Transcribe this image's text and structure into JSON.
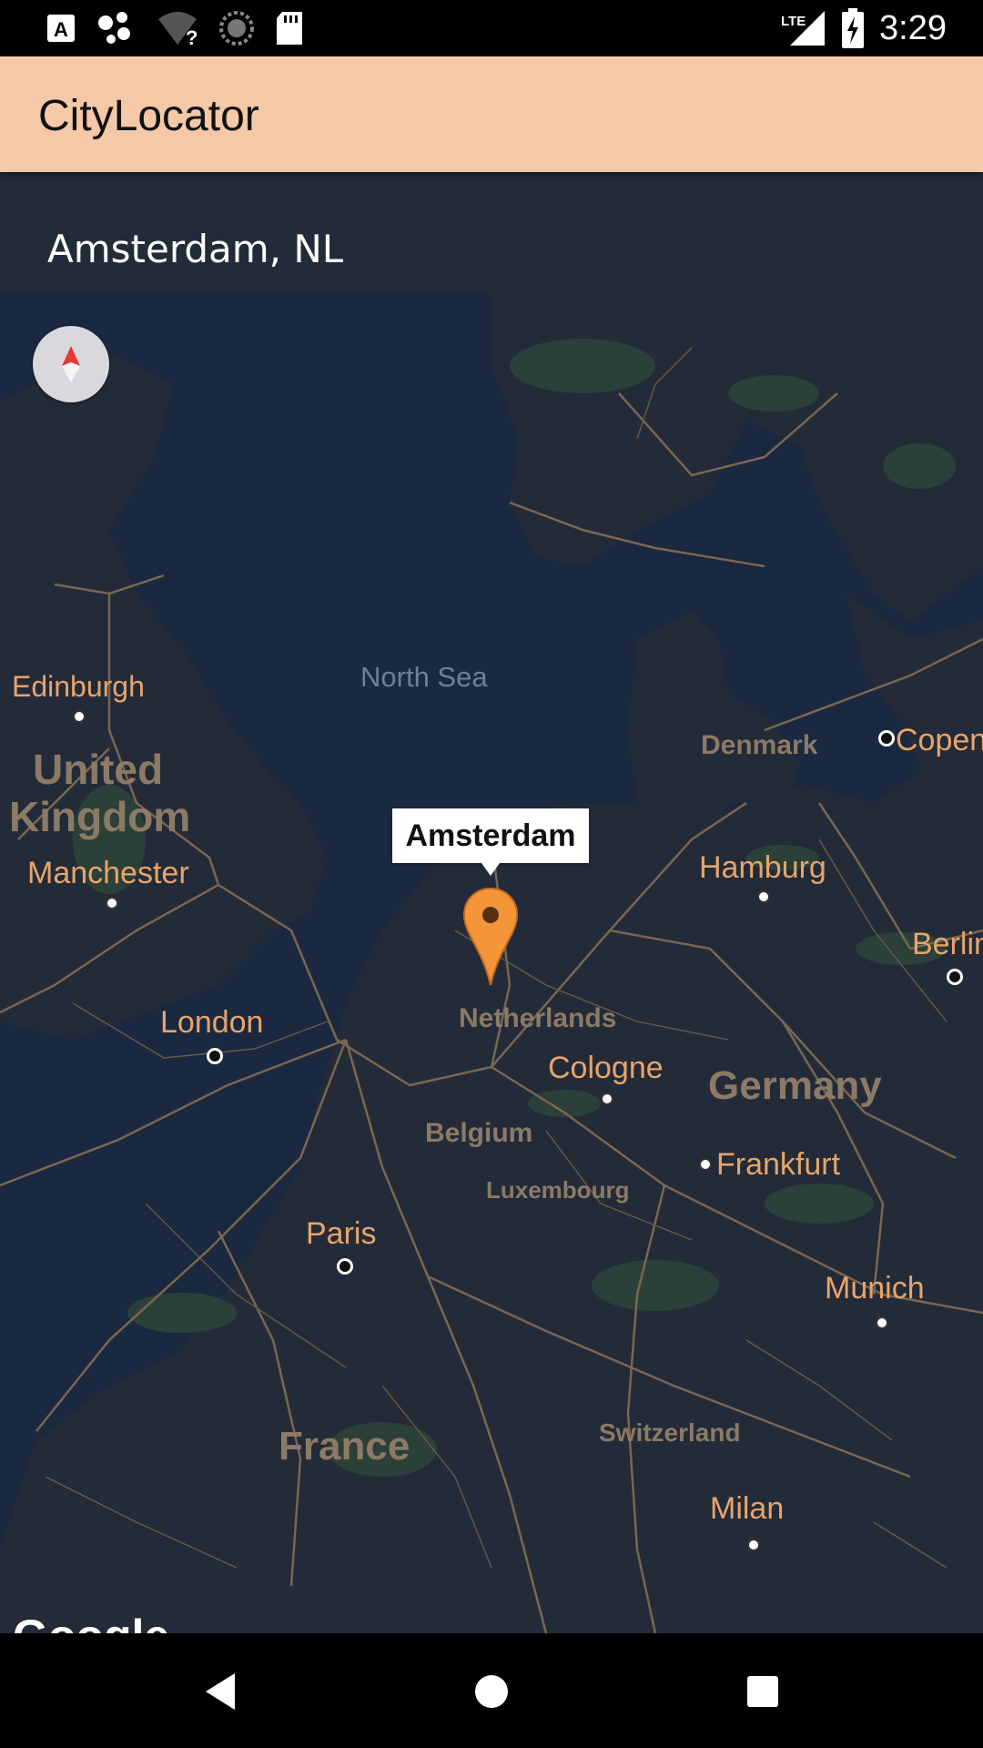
{
  "status_bar": {
    "time": "3:29",
    "network": "LTE",
    "left_icons": [
      "a-notification-icon",
      "assistant-dots-icon",
      "wifi-unknown-icon",
      "sync-circle-icon",
      "sd-card-icon"
    ],
    "right_icons": [
      "lte-signal-icon",
      "battery-charging-icon"
    ]
  },
  "app_bar": {
    "title": "CityLocator"
  },
  "city_bar": {
    "text": "Amsterdam, NL"
  },
  "map": {
    "sea_label": "North Sea",
    "marker": {
      "info_title": "Amsterdam",
      "pin_color": "#f4953a"
    },
    "cities": {
      "edinburgh": "Edinburgh",
      "manchester": "Manchester",
      "london": "London",
      "paris": "Paris",
      "hamburg": "Hamburg",
      "cologne": "Cologne",
      "frankfurt": "Frankfurt",
      "munich": "Munich",
      "milan": "Milan",
      "berlin": "Berlin",
      "copenhagen": "Copen"
    },
    "countries": {
      "united_kingdom_1": "United",
      "united_kingdom_2": "Kingdom",
      "denmark": "Denmark",
      "netherlands": "Netherlands",
      "belgium": "Belgium",
      "luxembourg": "Luxembourg",
      "germany": "Germany",
      "switzerland": "Switzerland",
      "france": "France"
    },
    "attribution": "Google",
    "colors": {
      "water": "#1a2840",
      "land": "#232b39",
      "roads": "#7a6650",
      "city_label": "#e8a46b",
      "country_label": "#8c7a66"
    }
  },
  "nav_bar": {
    "icons": [
      "back-icon",
      "home-icon",
      "recents-icon"
    ]
  },
  "colors": {
    "app_bar": "#f5c9a8",
    "city_bar": "#222b38"
  }
}
